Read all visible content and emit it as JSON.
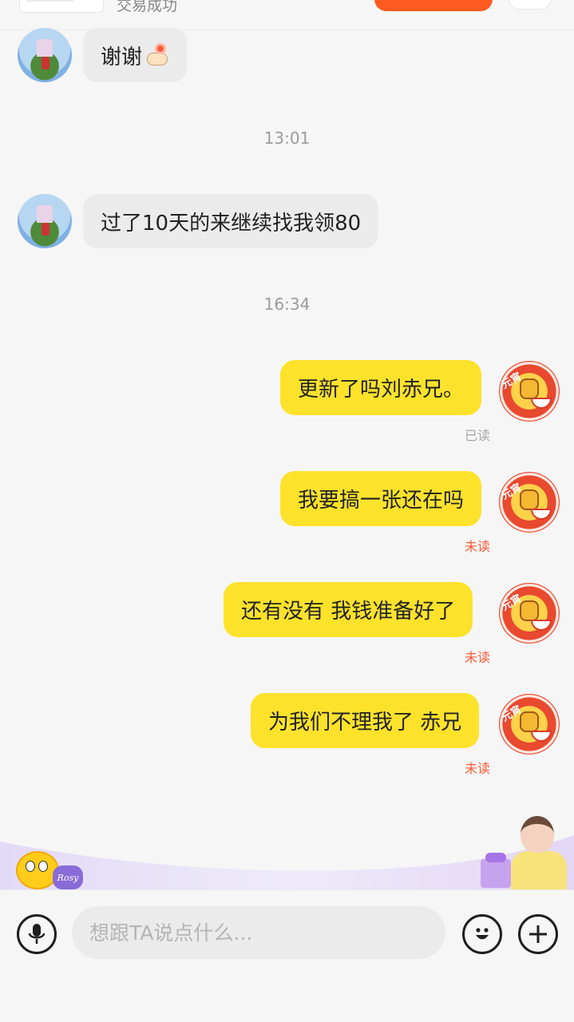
{
  "header": {
    "trade_status": "交易成功"
  },
  "messages": [
    {
      "side": "left",
      "text": "谢谢",
      "emoji": "flower-hand-emoji"
    },
    {
      "type": "timestamp",
      "text": "13:01"
    },
    {
      "side": "left",
      "text": "过了10天的来继续找我领80"
    },
    {
      "type": "timestamp",
      "text": "16:34"
    },
    {
      "side": "right",
      "text": "更新了吗刘赤兄。",
      "status": "已读"
    },
    {
      "side": "right",
      "text": "我要搞一张还在吗",
      "status": "未读"
    },
    {
      "side": "right",
      "text": "还有没有 我钱准备好了",
      "status": "未读"
    },
    {
      "side": "right",
      "text": "为我们不理我了 赤兄",
      "status": "未读"
    }
  ],
  "avatar_right_tag": "元宵",
  "banner": {
    "mascot_tag": "Rosy"
  },
  "input_bar": {
    "placeholder": "想跟TA说点什么...",
    "icons": [
      "microphone-icon",
      "emoji-icon",
      "plus-icon"
    ]
  },
  "colors": {
    "sent_bubble": "#fde22b",
    "received_bubble": "#ebebeb",
    "unread": "#ff5a36",
    "read": "#a6a6a6",
    "accent": "#ff5a1f"
  }
}
